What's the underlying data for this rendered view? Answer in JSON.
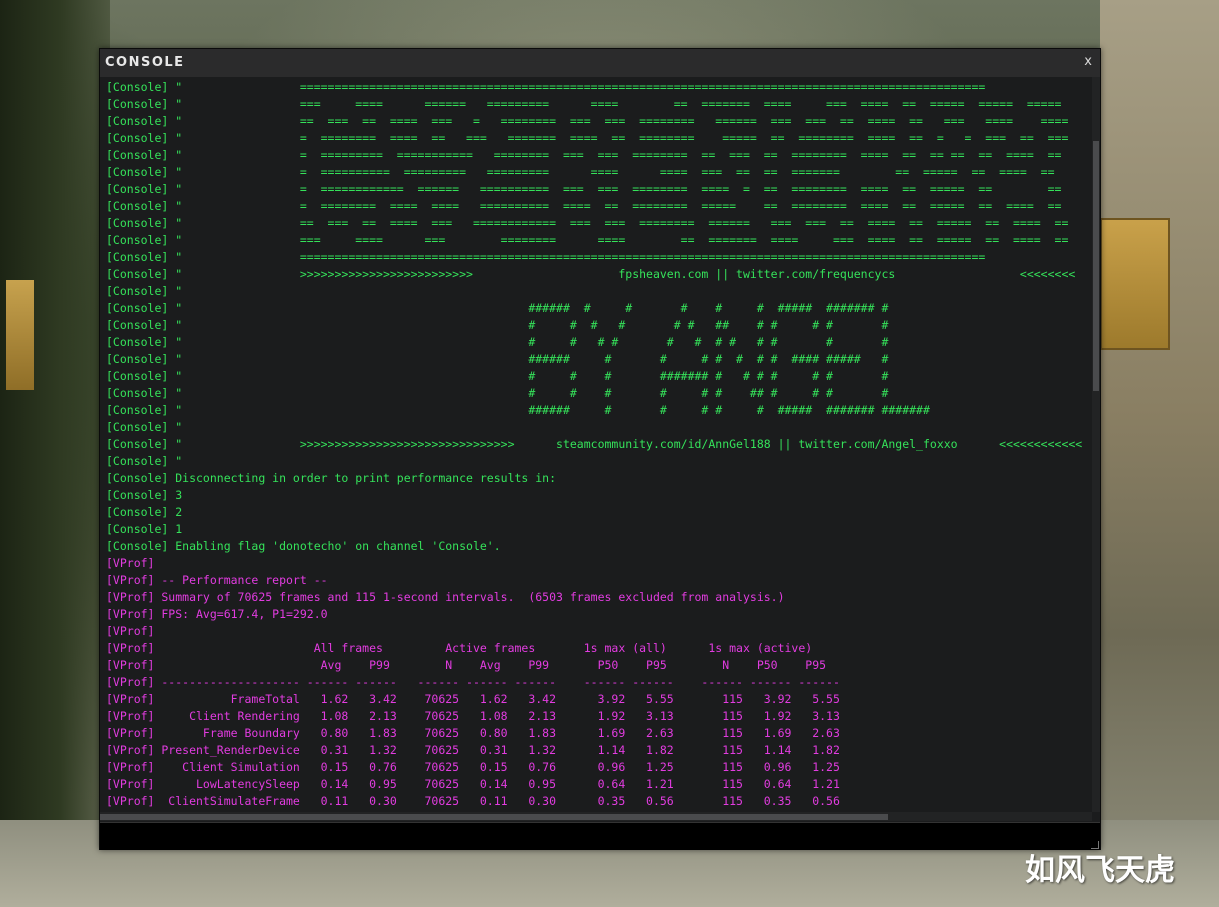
{
  "window": {
    "title": "CONSOLE",
    "close_label": "x"
  },
  "console_lines": [
    {
      "color": "green",
      "text": "[Console] \"                 ==================================================================================================="
    },
    {
      "color": "green",
      "text": "[Console] \"                 ===     ====      ======   =========      ====        ==  =======  ====     ===  ====  ==  =====  =====  ====="
    },
    {
      "color": "green",
      "text": "[Console] \"                 ==  ===  ==  ====  ===   =   ========  ===  ===  ========   ======  ===  ===  ==  ====  ==   ===   ====    ===="
    },
    {
      "color": "green",
      "text": "[Console] \"                 =  ========  ====  ==   ===   =======  ====  ==  ========    =====  ==  ========  ====  ==  =   =  ===  ==  ==="
    },
    {
      "color": "green",
      "text": "[Console] \"                 =  =========  ===========   ========  ===  ===  ========  ==  ===  ==  ========  ====  ==  == ==  ==  ====  =="
    },
    {
      "color": "green",
      "text": "[Console] \"                 =  ==========  =========   =========      ====      ====  ===  ==  ==  =======        ==  =====  ==  ====  =="
    },
    {
      "color": "green",
      "text": "[Console] \"                 =  ============  ======   ==========  ===  ===  ========  ====  =  ==  ========  ====  ==  =====  ==        =="
    },
    {
      "color": "green",
      "text": "[Console] \"                 =  ========  ====  ====   ==========  ====  ==  ========  =====    ==  ========  ====  ==  =====  ==  ====  =="
    },
    {
      "color": "green",
      "text": "[Console] \"                 ==  ===  ==  ====  ===   ============  ===  ===  ========  ======   ===  ===  ==  ====  ==  =====  ==  ====  =="
    },
    {
      "color": "green",
      "text": "[Console] \"                 ===     ====      ===        ========      ====        ==  =======  ====     ===  ====  ==  =====  ==  ====  =="
    },
    {
      "color": "green",
      "text": "[Console] \"                 ==================================================================================================="
    },
    {
      "color": "green",
      "text": "[Console] \"                 >>>>>>>>>>>>>>>>>>>>>>>>>                     fpsheaven.com || twitter.com/frequencycs                  <<<<<<<<"
    },
    {
      "color": "green",
      "text": "[Console] \""
    },
    {
      "color": "green",
      "text": "[Console] \"                                                  ######  #     #       #    #     #  #####  ####### #"
    },
    {
      "color": "green",
      "text": "[Console] \"                                                  #     #  #   #       # #   ##    # #     # #       #"
    },
    {
      "color": "green",
      "text": "[Console] \"                                                  #     #   # #       #   #  # #   # #       #       #"
    },
    {
      "color": "green",
      "text": "[Console] \"                                                  ######     #       #     # #  #  # #  #### #####   #"
    },
    {
      "color": "green",
      "text": "[Console] \"                                                  #     #    #       ####### #   # # #     # #       #"
    },
    {
      "color": "green",
      "text": "[Console] \"                                                  #     #    #       #     # #    ## #     # #       #"
    },
    {
      "color": "green",
      "text": "[Console] \"                                                  ######     #       #     # #     #  #####  ####### #######"
    },
    {
      "color": "green",
      "text": "[Console] \""
    },
    {
      "color": "green",
      "text": "[Console] \"                 >>>>>>>>>>>>>>>>>>>>>>>>>>>>>>>      steamcommunity.com/id/AnnGel188 || twitter.com/Angel_foxxo      <<<<<<<<<<<<"
    },
    {
      "color": "green",
      "text": "[Console] \""
    },
    {
      "color": "green",
      "text": "[Console] Disconnecting in order to print performance results in:"
    },
    {
      "color": "green",
      "text": "[Console] 3"
    },
    {
      "color": "green",
      "text": "[Console] 2"
    },
    {
      "color": "green",
      "text": "[Console] 1"
    },
    {
      "color": "green",
      "text": "[Console] Enabling flag 'donotecho' on channel 'Console'."
    },
    {
      "color": "magenta",
      "text": "[VProf]"
    },
    {
      "color": "magenta",
      "text": "[VProf] -- Performance report --"
    },
    {
      "color": "magenta",
      "text": "[VProf] Summary of 70625 frames and 115 1-second intervals.  (6503 frames excluded from analysis.)"
    },
    {
      "color": "magenta",
      "text": "[VProf] FPS: Avg=617.4, P1=292.0"
    },
    {
      "color": "magenta",
      "text": "[VProf]"
    },
    {
      "color": "magenta",
      "text": "[VProf]                       All frames         Active frames       1s max (all)      1s max (active)"
    },
    {
      "color": "magenta",
      "text": "[VProf]                        Avg    P99        N    Avg    P99       P50    P95        N    P50    P95"
    },
    {
      "color": "magenta",
      "text": "[VProf] -------------------- ------ ------   ------ ------ ------    ------ ------    ------ ------ ------"
    },
    {
      "color": "magenta",
      "text": "[VProf]           FrameTotal   1.62   3.42    70625   1.62   3.42      3.92   5.55       115   3.92   5.55"
    },
    {
      "color": "magenta",
      "text": "[VProf]     Client Rendering   1.08   2.13    70625   1.08   2.13      1.92   3.13       115   1.92   3.13"
    },
    {
      "color": "magenta",
      "text": "[VProf]       Frame Boundary   0.80   1.83    70625   0.80   1.83      1.69   2.63       115   1.69   2.63"
    },
    {
      "color": "magenta",
      "text": "[VProf] Present_RenderDevice   0.31   1.32    70625   0.31   1.32      1.14   1.82       115   1.14   1.82"
    },
    {
      "color": "magenta",
      "text": "[VProf]    Client Simulation   0.15   0.76    70625   0.15   0.76      0.96   1.25       115   0.96   1.25"
    },
    {
      "color": "magenta",
      "text": "[VProf]      LowLatencySleep   0.14   0.95    70625   0.14   0.95      0.64   1.21       115   0.64   1.21"
    },
    {
      "color": "magenta",
      "text": "[VProf]  ClientSimulateFrame   0.11   0.30    70625   0.11   0.30      0.35   0.56       115   0.35   0.56"
    }
  ],
  "colors": {
    "green": "#35e25a",
    "magenta": "#e23ce0",
    "background": "#1b1c1d",
    "titlebar": "#2b2b2c"
  },
  "watermark": "如风飞天虎"
}
